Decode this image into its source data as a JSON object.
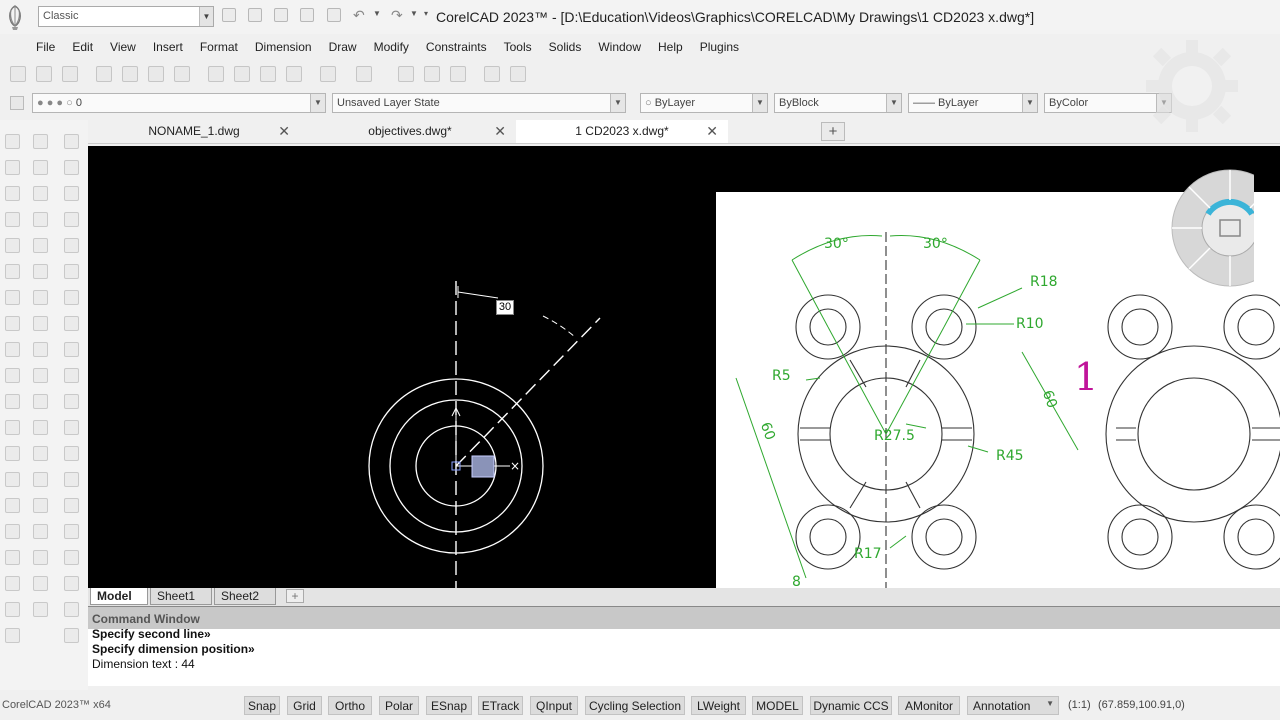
{
  "titlebar": {
    "workspace": "Classic",
    "window_title": "CorelCAD 2023™ - [D:\\Education\\Videos\\Graphics\\CORELCAD\\My Drawings\\1 CD2023 x.dwg*]"
  },
  "menu": {
    "items": [
      "File",
      "Edit",
      "View",
      "Insert",
      "Format",
      "Dimension",
      "Draw",
      "Modify",
      "Constraints",
      "Tools",
      "Solids",
      "Window",
      "Help",
      "Plugins"
    ]
  },
  "properties": {
    "layer_value": "0",
    "layer_state": "Unsaved Layer State",
    "color": "ByLayer",
    "linestyle": "ByBlock",
    "lineweight": "—— ByLayer",
    "print_style": "ByColor"
  },
  "doc_tabs": [
    {
      "label": "NONAME_1.dwg",
      "active": false
    },
    {
      "label": "objectives.dwg*",
      "active": false
    },
    {
      "label": "1 CD2023 x.dwg*",
      "active": true
    }
  ],
  "canvas": {
    "dimension_input": "30",
    "reference": {
      "angle_left": "30°",
      "angle_right": "30°",
      "r18": "R18",
      "r10": "R10",
      "r5": "R5",
      "r275": "R27.5",
      "r45": "R45",
      "r17": "R17",
      "d60_left": "60",
      "d60_right": "60",
      "d8": "8",
      "figure_number": "1"
    }
  },
  "layout_tabs": [
    "Model",
    "Sheet1",
    "Sheet2"
  ],
  "command_window": {
    "title": "Command Window",
    "lines": [
      "Specify second line»",
      "Specify dimension position»",
      "Dimension text : 44"
    ]
  },
  "statusbar": {
    "app_version": "CorelCAD 2023™ x64",
    "buttons": [
      "Snap",
      "Grid",
      "Ortho",
      "Polar",
      "ESnap",
      "ETrack",
      "QInput",
      "Cycling Selection",
      "LWeight",
      "MODEL",
      "Dynamic CCS",
      "AMonitor"
    ],
    "annotation": "Annotation",
    "scale": "(1:1)",
    "coords": "(67.859,100.91,0)"
  },
  "colors": {
    "dim_green": "#2fa82f",
    "figure_magenta": "#c0149a",
    "canvas_bg": "#000000"
  }
}
